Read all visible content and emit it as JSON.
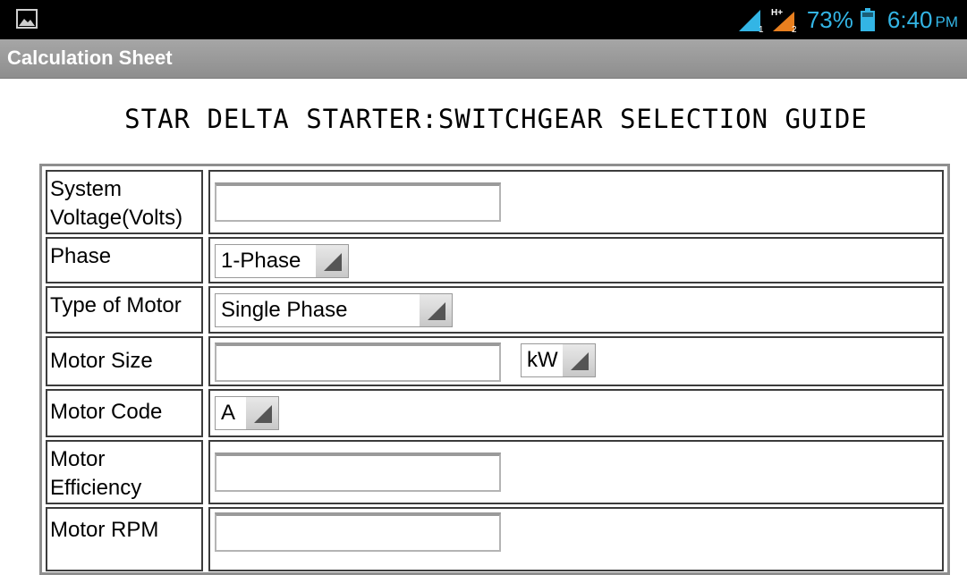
{
  "status_bar": {
    "battery_percent": "73%",
    "time": "6:40",
    "ampm": "PM",
    "network_type": "H+",
    "sim1_label": "1",
    "sim2_label": "2",
    "accent_color": "#33b5e5"
  },
  "app_bar": {
    "title": "Calculation Sheet"
  },
  "page": {
    "heading": "STAR DELTA STARTER:SWITCHGEAR SELECTION GUIDE"
  },
  "form": {
    "system_voltage": {
      "label": "System Voltage(Volts)",
      "value": ""
    },
    "phase": {
      "label": "Phase",
      "selected": "1-Phase"
    },
    "motor_type": {
      "label": "Type of Motor",
      "selected": "Single Phase"
    },
    "motor_size": {
      "label": "Motor Size",
      "value": "",
      "unit_selected": "kW"
    },
    "motor_code": {
      "label": "Motor Code",
      "selected": "A"
    },
    "motor_efficiency": {
      "label": "Motor Efficiency",
      "value": ""
    },
    "motor_rpm": {
      "label": "Motor RPM",
      "value": ""
    }
  }
}
